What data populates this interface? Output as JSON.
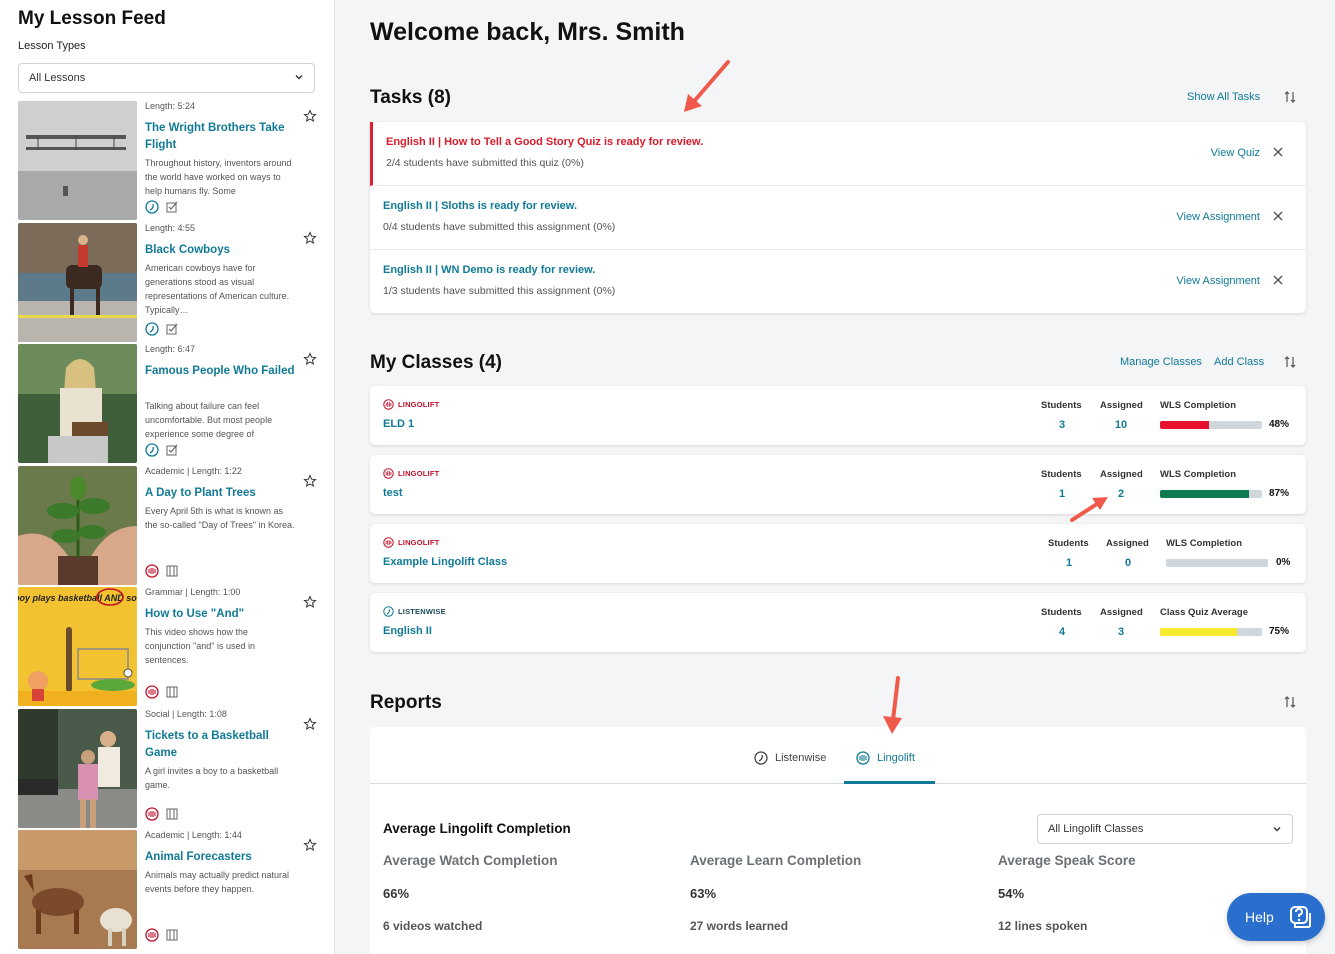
{
  "sidebar": {
    "title": "My Lesson Feed",
    "lesson_types_label": "Lesson Types",
    "lesson_type_selected": "All Lessons",
    "lessons": [
      {
        "meta": "Length: 5:24",
        "title": "The Wright Brothers Take Flight",
        "desc": "Throughout history, inventors around the world have worked on ways to help humans fly. Some",
        "kind": "listenwise"
      },
      {
        "meta": "Length: 4:55",
        "title": "Black Cowboys",
        "desc": "American cowboys have for generations stood as visual representations of American culture. Typically…",
        "kind": "listenwise"
      },
      {
        "meta": "Length: 6:47",
        "title": "Famous People Who Failed",
        "desc": "Talking about failure can feel uncomfortable. But most people experience some degree of",
        "kind": "listenwise"
      },
      {
        "meta": "Academic | Length: 1:22",
        "title": "A Day to Plant Trees",
        "desc": "Every April 5th is what is known as the so-called \"Day of Trees\" in Korea.",
        "kind": "lingolift"
      },
      {
        "meta": "Grammar | Length: 1:00",
        "title": "How to Use \"And\"",
        "desc": "This video shows how the conjunction \"and\" is used in sentences.",
        "kind": "lingolift",
        "thumb_text": "boy plays basketball AND socc"
      },
      {
        "meta": "Social | Length: 1:08",
        "title": "Tickets to a Basketball Game",
        "desc": "A girl invites a boy to a basketball game.",
        "kind": "lingolift"
      },
      {
        "meta": "Academic | Length: 1:44",
        "title": "Animal Forecasters",
        "desc": "Animals may actually predict natural events before they happen.",
        "kind": "lingolift"
      }
    ]
  },
  "main": {
    "welcome": "Welcome back, Mrs. Smith",
    "tasks": {
      "heading": "Tasks (8)",
      "show_all": "Show All Tasks",
      "items": [
        {
          "title": "English II | How to Tell a Good Story Quiz is ready for review.",
          "sub": "2/4 students have submitted this quiz (0%)",
          "action": "View Quiz"
        },
        {
          "title": "English II | Sloths is ready for review.",
          "sub": "0/4 students have submitted this assignment (0%)",
          "action": "View Assignment"
        },
        {
          "title": "English II | WN Demo is ready for review.",
          "sub": "1/3 students have submitted this assignment (0%)",
          "action": "View Assignment"
        }
      ]
    },
    "classes": {
      "heading": "My Classes (4)",
      "manage": "Manage Classes",
      "add": "Add Class",
      "students_label": "Students",
      "assigned_label": "Assigned",
      "items": [
        {
          "brand": "LINGOLIFT",
          "name": "ELD 1",
          "students": "3",
          "assigned": "10",
          "metric_label": "WLS Completion",
          "pct": "48%",
          "fill": 0.48,
          "color": "#e8112d"
        },
        {
          "brand": "LINGOLIFT",
          "name": "test",
          "students": "1",
          "assigned": "2",
          "metric_label": "WLS Completion",
          "pct": "87%",
          "fill": 0.87,
          "color": "#0d7a50"
        },
        {
          "brand": "LINGOLIFT",
          "name": "Example Lingolift Class",
          "students": "1",
          "assigned": "0",
          "metric_label": "WLS Completion",
          "pct": "0%",
          "fill": 0,
          "color": "#0d7a50"
        },
        {
          "brand": "LISTENWISE",
          "name": "English II",
          "students": "4",
          "assigned": "3",
          "metric_label": "Class Quiz Average",
          "pct": "75%",
          "fill": 0.75,
          "color": "#f6ea2c"
        }
      ]
    },
    "reports": {
      "heading": "Reports",
      "tab_listenwise": "Listenwise",
      "tab_lingolift": "Lingolift",
      "avg_heading": "Average Lingolift Completion",
      "class_select": "All Lingolift Classes",
      "stats": [
        {
          "label": "Average Watch Completion",
          "value": "66%",
          "sub": "6 videos watched"
        },
        {
          "label": "Average Learn Completion",
          "value": "63%",
          "sub": "27 words learned"
        },
        {
          "label": "Average Speak Score",
          "value": "54%",
          "sub": "12 lines spoken"
        }
      ]
    },
    "help_label": "Help"
  },
  "colors": {
    "accent": "#117a96",
    "alert": "#d81b2a",
    "lingolift": "#c0102a",
    "help": "#2a6fce"
  }
}
